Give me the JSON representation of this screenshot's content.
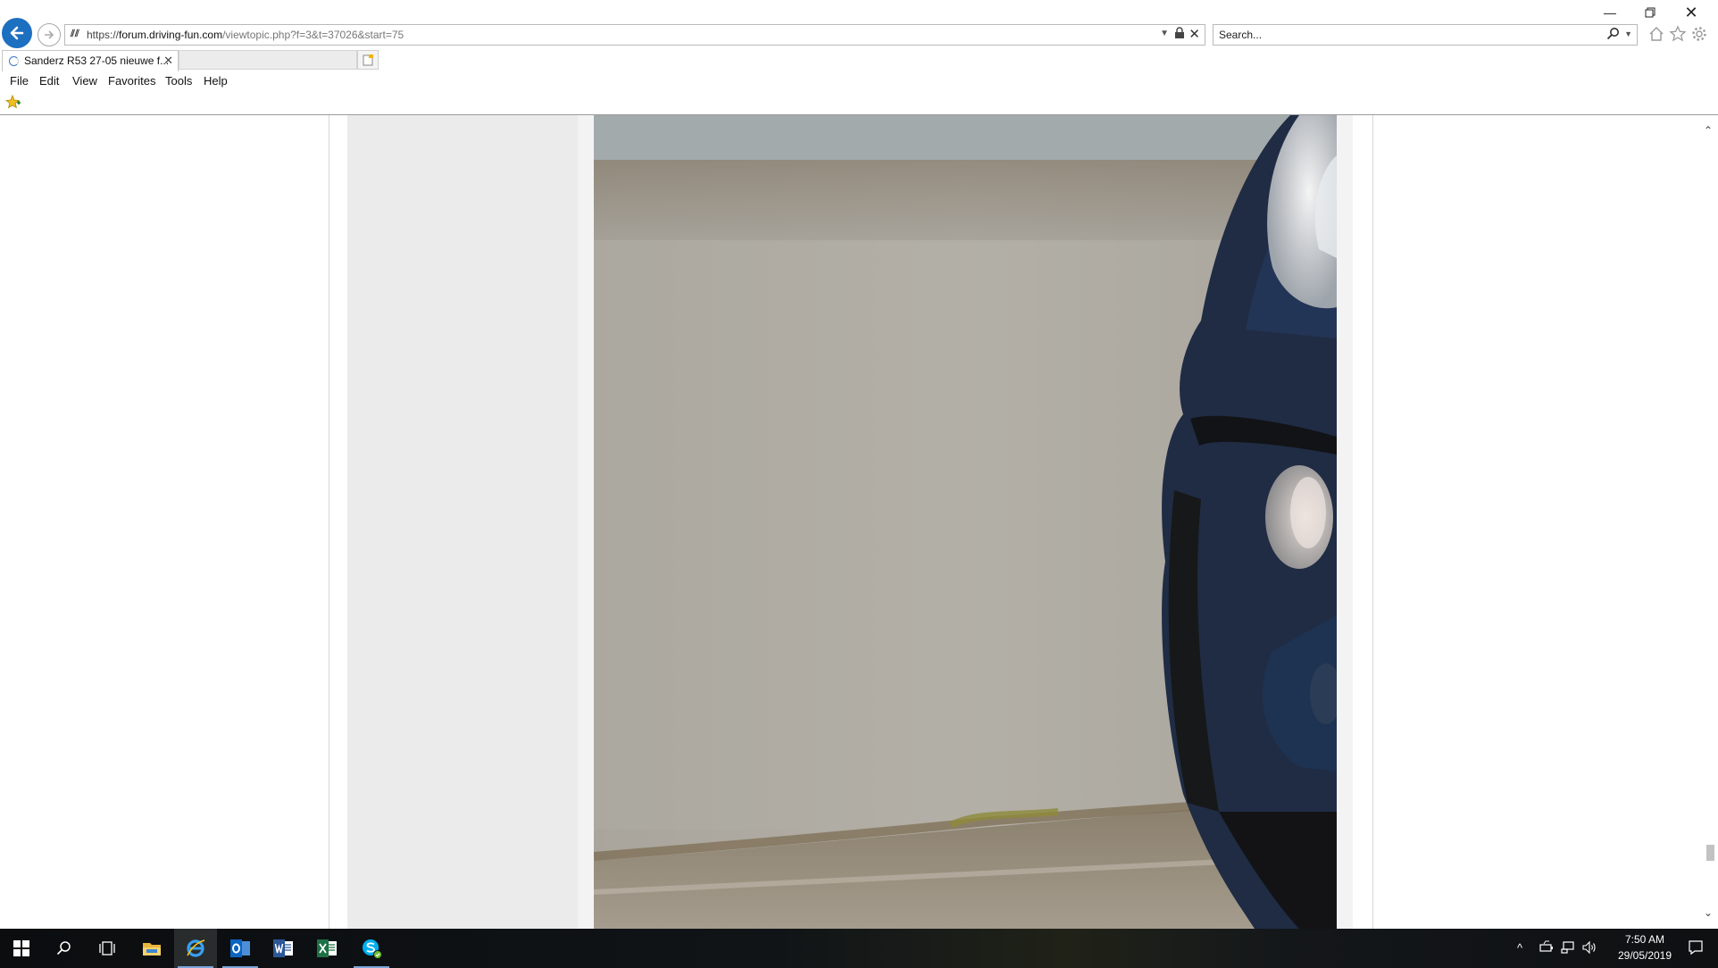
{
  "browser": {
    "address": {
      "url_scheme": "https://",
      "url_host": "forum.driving-fun.com",
      "url_path": "/viewtopic.php?f=3&t=37026&start=75"
    },
    "search": {
      "placeholder": "Search..."
    },
    "tabs": [
      {
        "title": "Sanderz R53 27-05 nieuwe f...",
        "active": true,
        "loading": true
      }
    ],
    "menu": {
      "file": "File",
      "edit": "Edit",
      "view": "View",
      "favorites": "Favorites",
      "tools": "Tools",
      "help": "Help"
    },
    "icons": [
      "back-arrow-icon",
      "forward-arrow-icon",
      "site-icon",
      "lock-icon",
      "search-icon",
      "home-icon",
      "favorites-star-icon",
      "settings-gear-icon",
      "add-favorite-icon",
      "new-tab-icon"
    ]
  },
  "page": {
    "photo": {
      "subject": "photo-of-car-front"
    }
  },
  "taskbar": {
    "apps": [
      "windows-start",
      "search",
      "task-view",
      "file-explorer",
      "internet-explorer",
      "outlook",
      "word",
      "excel",
      "skype"
    ],
    "active_app": "internet-explorer",
    "clock": {
      "time": "7:50 AM",
      "date": "29/05/2019"
    }
  },
  "colors": {
    "accent": "#1d6fc0",
    "taskbar": "#101417",
    "content_panel": "#f3f3f3",
    "profile_column": "#ebebeb"
  }
}
